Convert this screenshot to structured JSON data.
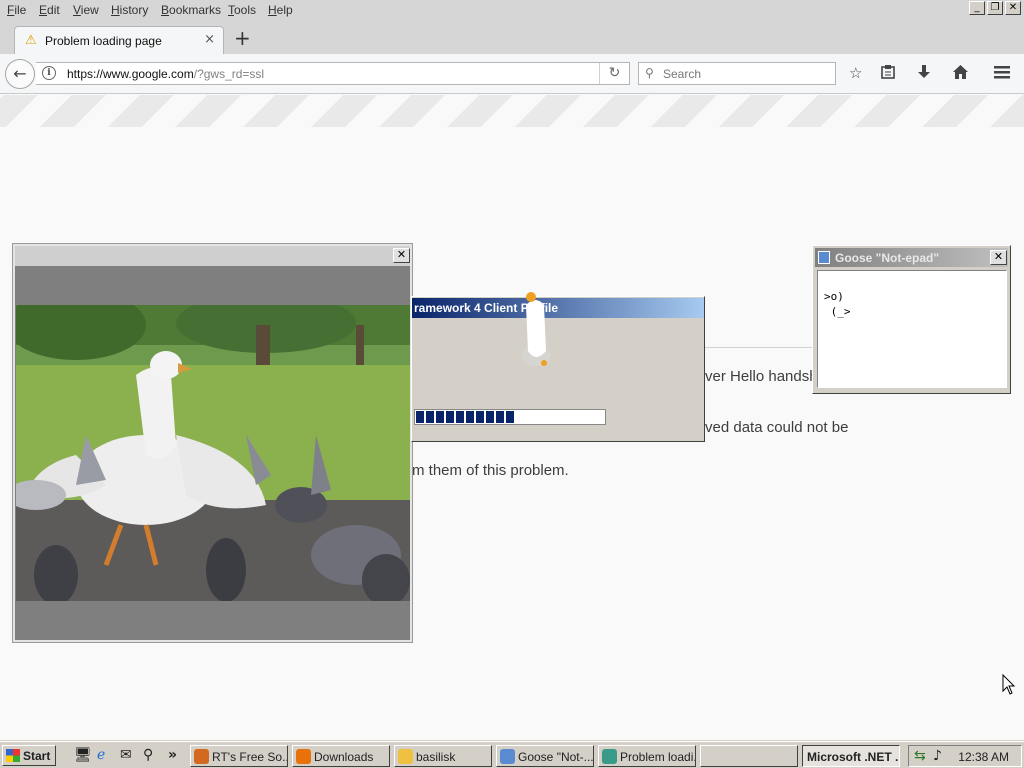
{
  "menubar": {
    "items": [
      "File",
      "Edit",
      "View",
      "History",
      "Bookmarks",
      "Tools",
      "Help"
    ],
    "window_controls": {
      "minimize": "_",
      "restore": "❐",
      "close": "✕"
    }
  },
  "tabs": {
    "active_title": "Problem loading page",
    "close": "×",
    "new_tab": "+"
  },
  "navbar": {
    "url_host": "https://www.google.com",
    "url_path": "/?gws_rd=ssl",
    "search_placeholder": "Search",
    "icons": [
      "bookmark-star-icon",
      "reading-list-icon",
      "downloads-icon",
      "home-icon",
      "menu-icon"
    ]
  },
  "error_page": {
    "lines": [
      "ver Hello handsh",
      "ved data could not be",
      "m them of this problem."
    ]
  },
  "video_window": {
    "close": "✕"
  },
  "net_installer": {
    "title": "ramework 4 Client Profile",
    "progress": 0.52
  },
  "notepad": {
    "title": "Goose \"Not-epad\"",
    "close": "✕",
    "content": ">o)\n (_>"
  },
  "taskbar": {
    "start_label": "Start",
    "quicklaunch_more": "»",
    "tasks": [
      {
        "label": "RT's Free So...",
        "color": "#d2691e",
        "pressed": false
      },
      {
        "label": "Downloads",
        "color": "#e8710a",
        "pressed": false
      },
      {
        "label": "basilisk",
        "color": "#f0c040",
        "pressed": false
      },
      {
        "label": "Goose \"Not-...",
        "color": "#5a8ad0",
        "pressed": false
      },
      {
        "label": "Problem loadi...",
        "color": "#3a9a8a",
        "pressed": false
      },
      {
        "label": "",
        "color": "",
        "pressed": false
      },
      {
        "label": "Microsoft .NET ...",
        "color": "",
        "pressed": true
      }
    ],
    "clock": "12:38 AM"
  }
}
